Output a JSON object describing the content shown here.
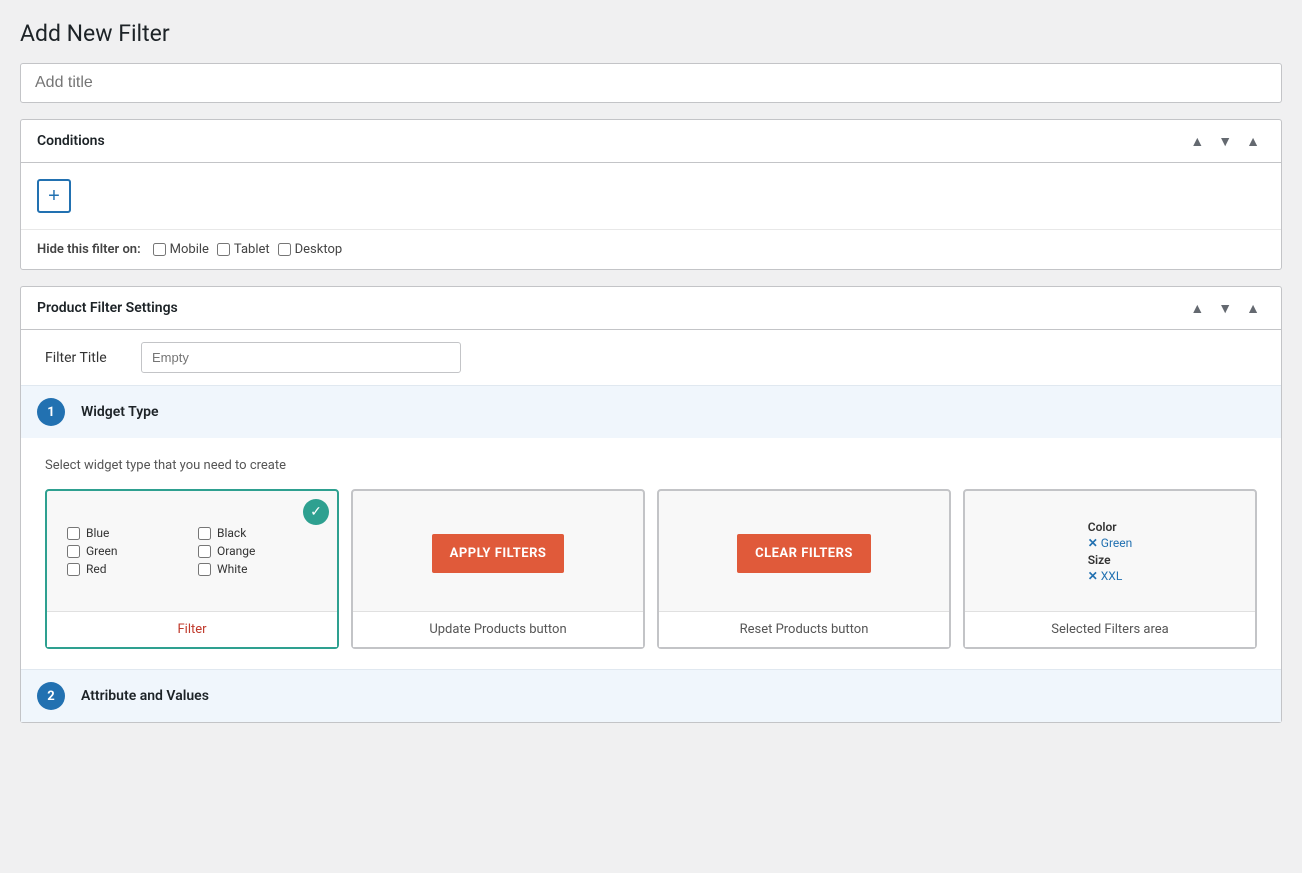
{
  "page": {
    "title": "Add New Filter"
  },
  "title_input": {
    "placeholder": "Add title",
    "value": ""
  },
  "conditions_panel": {
    "title": "Conditions",
    "add_btn_label": "+",
    "hide_label": "Hide this filter on:",
    "hide_options": [
      "Mobile",
      "Tablet",
      "Desktop"
    ],
    "ctrl_up": "▲",
    "ctrl_down": "▼",
    "ctrl_collapse": "▲"
  },
  "product_filter_panel": {
    "title": "Product Filter Settings",
    "filter_title_label": "Filter Title",
    "filter_title_placeholder": "Empty",
    "widget_section_number": "1",
    "widget_section_title": "Widget Type",
    "widget_description": "Select widget type that you need to create",
    "widget_options": [
      {
        "id": "filter",
        "label": "Filter",
        "selected": true,
        "preview_type": "filter_checkboxes"
      },
      {
        "id": "update_products",
        "label": "Update Products button",
        "selected": false,
        "preview_type": "apply_button"
      },
      {
        "id": "reset_products",
        "label": "Reset Products button",
        "selected": false,
        "preview_type": "clear_button"
      },
      {
        "id": "selected_filters",
        "label": "Selected Filters area",
        "selected": false,
        "preview_type": "selected_filters"
      }
    ],
    "filter_checkboxes": [
      {
        "label": "Blue",
        "checked": false
      },
      {
        "label": "Black",
        "checked": false
      },
      {
        "label": "Green",
        "checked": false
      },
      {
        "label": "Orange",
        "checked": false
      },
      {
        "label": "Red",
        "checked": false
      },
      {
        "label": "White",
        "checked": false
      }
    ],
    "apply_button_text": "APPLY FILTERS",
    "clear_button_text": "CLEAR FILTERS",
    "selected_filters_color_label": "Color",
    "selected_filters_color_tag": "Green",
    "selected_filters_size_label": "Size",
    "selected_filters_size_tag": "XXL",
    "attribute_section_number": "2",
    "attribute_section_title": "Attribute and Values"
  }
}
